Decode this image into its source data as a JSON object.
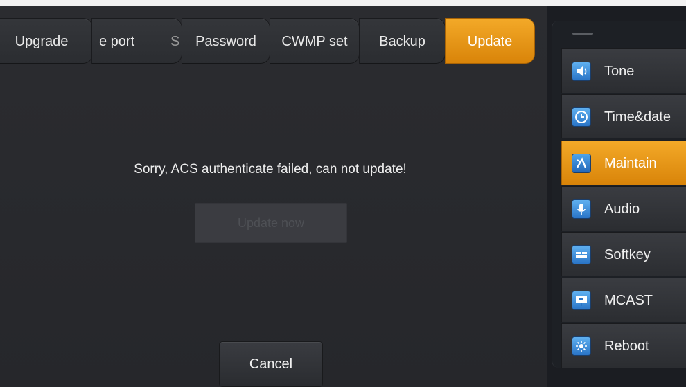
{
  "tabs": [
    {
      "label": "Upgrade",
      "active": false
    },
    {
      "label": "e port",
      "fragment": "S",
      "active": false
    },
    {
      "label": "Password",
      "active": false
    },
    {
      "label": "CWMP set",
      "active": false
    },
    {
      "label": "Backup",
      "active": false
    },
    {
      "label": "Update",
      "active": true
    }
  ],
  "main": {
    "message": "Sorry, ACS authenticate failed, can not update!",
    "update_now_label": "Update now",
    "cancel_label": "Cancel"
  },
  "sidebar": {
    "items": [
      {
        "label": "Tone",
        "icon": "speaker-icon",
        "active": false
      },
      {
        "label": "Time&date",
        "icon": "clock-icon",
        "active": false
      },
      {
        "label": "Maintain",
        "icon": "tools-icon",
        "active": true
      },
      {
        "label": "Audio",
        "icon": "microphone-icon",
        "active": false
      },
      {
        "label": "Softkey",
        "icon": "keyboard-icon",
        "active": false
      },
      {
        "label": "MCAST",
        "icon": "multicast-icon",
        "active": false
      },
      {
        "label": "Reboot",
        "icon": "reboot-icon",
        "active": false
      }
    ]
  },
  "colors": {
    "accent": "#e8960f",
    "background": "#2b2c30",
    "icon_blue": "#3b8ad8"
  }
}
